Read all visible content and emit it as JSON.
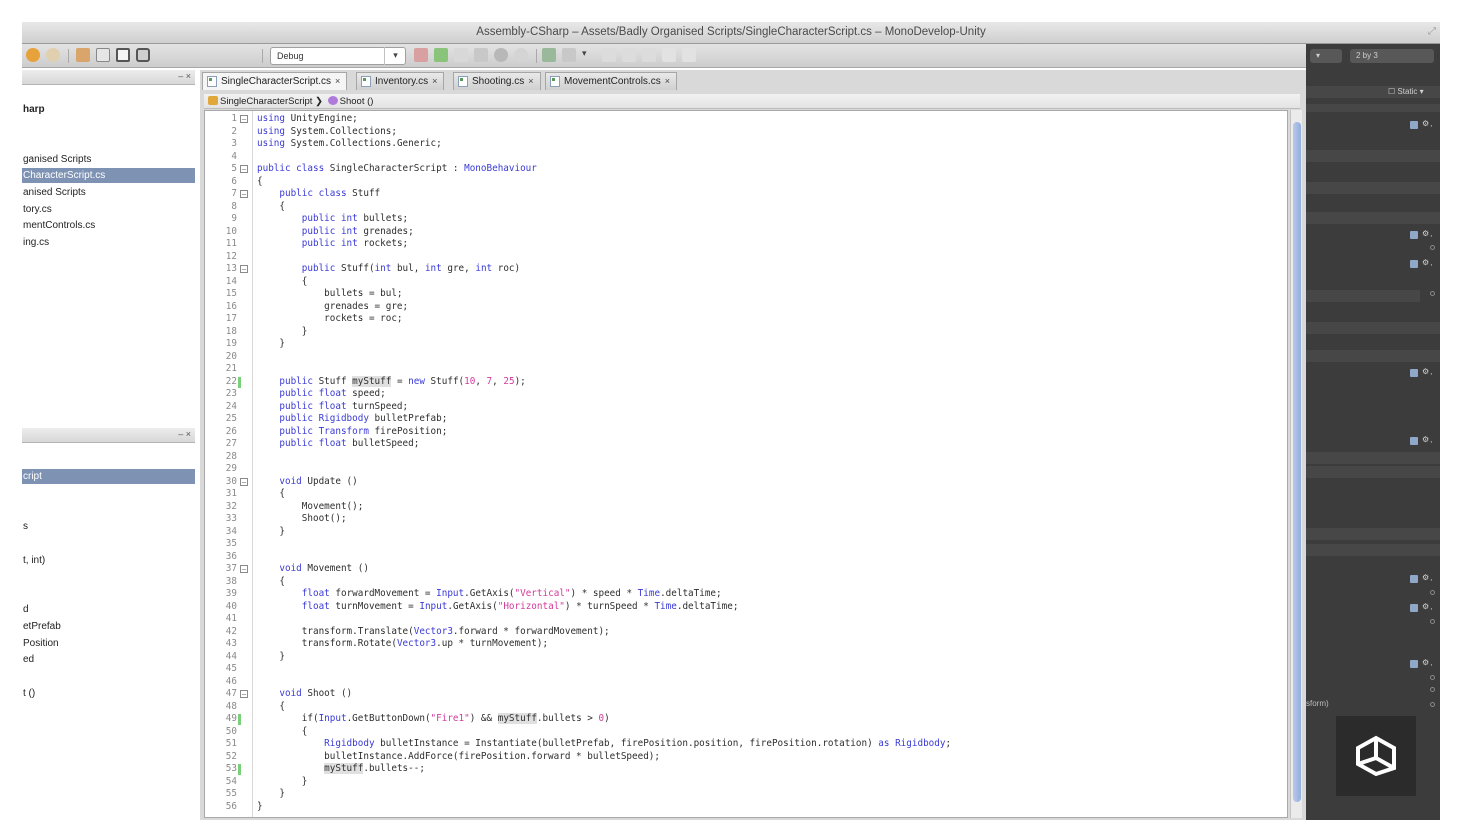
{
  "window": {
    "title": "Assembly-CSharp – Assets/Badly Organised Scripts/SingleCharacterScript.cs – MonoDevelop-Unity"
  },
  "toolbar": {
    "config": "Debug",
    "icons": [
      "back-arrow-icon",
      "forward-arrow-icon",
      "cut-icon",
      "copy-icon",
      "paste-icon",
      "save-icon",
      "build-icon",
      "clean-icon",
      "run-icon",
      "breakpoint-icon"
    ]
  },
  "solution_pad": {
    "items": [
      {
        "label": "harp",
        "bold": true
      },
      {
        "label": "ganised Scripts"
      },
      {
        "label": "CharacterScript.cs",
        "selected": true
      },
      {
        "label": "anised Scripts"
      },
      {
        "label": "tory.cs"
      },
      {
        "label": "mentControls.cs"
      },
      {
        "label": "ing.cs"
      }
    ]
  },
  "outline_pad": {
    "items": [
      {
        "label": "cript",
        "selected": true
      },
      {
        "label": "s"
      },
      {
        "label": "t, int)"
      },
      {
        "label": "d"
      },
      {
        "label": "etPrefab"
      },
      {
        "label": "Position"
      },
      {
        "label": "ed"
      },
      {
        "label": "t ()"
      }
    ]
  },
  "tabs": [
    {
      "label": "SingleCharacterScript.cs",
      "active": true
    },
    {
      "label": "Inventory.cs"
    },
    {
      "label": "Shooting.cs"
    },
    {
      "label": "MovementControls.cs"
    }
  ],
  "pathbar": {
    "class_name": "SingleCharacterScript",
    "method_name": "Shoot ()"
  },
  "unity_panel": {
    "layout_dropdown": "2 by 3",
    "static_label": "Static",
    "transform_fragment": "sform)"
  },
  "code_lines": [
    "<span class=\"kw\">using</span> UnityEngine;",
    "<span class=\"kw\">using</span> System.Collections;",
    "<span class=\"kw\">using</span> System.Collections.Generic;",
    "",
    "<span class=\"kw\">public class</span> SingleCharacterScript : <span class=\"kw\">MonoBehaviour</span>",
    "{",
    "    <span class=\"kw\">public class</span> Stuff",
    "    {",
    "        <span class=\"kw\">public int</span> bullets;",
    "        <span class=\"kw\">public int</span> grenades;",
    "        <span class=\"kw\">public int</span> rockets;",
    "",
    "        <span class=\"kw\">public</span> Stuff(<span class=\"kw\">int</span> bul, <span class=\"kw\">int</span> gre, <span class=\"kw\">int</span> roc)",
    "        {",
    "            bullets = bul;",
    "            grenades = gre;",
    "            rockets = roc;",
    "        }",
    "    }",
    "",
    "",
    "    <span class=\"kw\">public</span> Stuff <span class=\"hl\">myStuff</span> = <span class=\"kw\">new</span> Stuff(<span class=\"num\">10</span>, <span class=\"num\">7</span>, <span class=\"num\">25</span>);",
    "    <span class=\"kw\">public float</span> speed;",
    "    <span class=\"kw\">public float</span> turnSpeed;",
    "    <span class=\"kw\">public Rigidbody</span> bulletPrefab;",
    "    <span class=\"kw\">public Transform</span> firePosition;",
    "    <span class=\"kw\">public float</span> bulletSpeed;",
    "",
    "",
    "    <span class=\"kw\">void</span> Update ()",
    "    {",
    "        Movement();",
    "        Shoot();",
    "    }",
    "",
    "",
    "    <span class=\"kw\">void</span> Movement ()",
    "    {",
    "        <span class=\"kw\">float</span> forwardMovement = <span class=\"kw\">Input</span>.GetAxis(<span class=\"str\">\"Vertical\"</span>) * speed * <span class=\"kw\">Time</span>.deltaTime;",
    "        <span class=\"kw\">float</span> turnMovement = <span class=\"kw\">Input</span>.GetAxis(<span class=\"str\">\"Horizontal\"</span>) * turnSpeed * <span class=\"kw\">Time</span>.deltaTime;",
    "",
    "        transform.Translate(<span class=\"kw\">Vector3</span>.forward * forwardMovement);",
    "        transform.Rotate(<span class=\"kw\">Vector3</span>.up * turnMovement);",
    "    }",
    "",
    "",
    "    <span class=\"kw\">void</span> Shoot ()",
    "    {",
    "        if(<span class=\"kw\">Input</span>.GetButtonDown(<span class=\"str\">\"Fire1\"</span>) &amp;&amp; <span class=\"hl\">myStuff</span>.bullets &gt; <span class=\"num\">0</span>)",
    "        {",
    "            <span class=\"kw\">Rigidbody</span> bulletInstance = Instantiate(bulletPrefab, firePosition.position, firePosition.rotation) <span class=\"kw\">as Rigidbody</span>;",
    "            bulletInstance.AddForce(firePosition.forward * bulletSpeed);",
    "            <span class=\"hl\">myStuff</span>.bullets--;",
    "        }",
    "    }",
    "}"
  ],
  "fold_lines": [
    1,
    5,
    7,
    13,
    30,
    37,
    47
  ],
  "changed_lines": [
    22,
    49,
    53
  ],
  "colors": {
    "keyword": "#3a3ad6",
    "string": "#d23a9a",
    "selection": "#7e93b4",
    "unity_dark": "#3c3c3c"
  }
}
